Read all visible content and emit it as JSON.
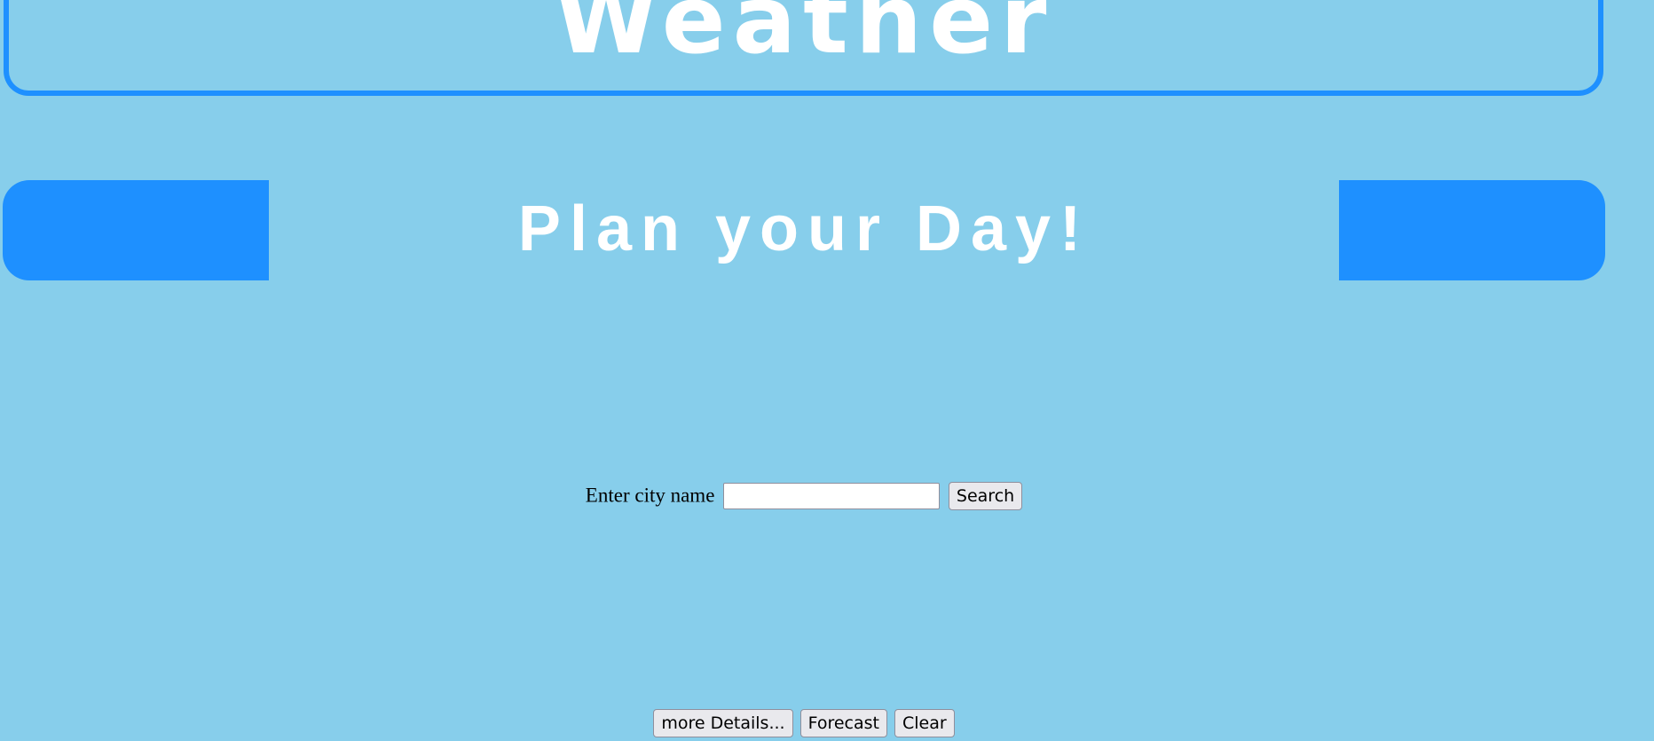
{
  "header": {
    "title": "Weather"
  },
  "banner": {
    "text": "Plan your Day!"
  },
  "search": {
    "label": "Enter city name",
    "input_value": "",
    "button_label": "Search"
  },
  "actions": {
    "details_label": "more Details...",
    "forecast_label": "Forecast",
    "clear_label": "Clear"
  },
  "colors": {
    "background": "#87CEEB",
    "accent": "#1E90FF",
    "text_light": "#FFFFFF"
  }
}
